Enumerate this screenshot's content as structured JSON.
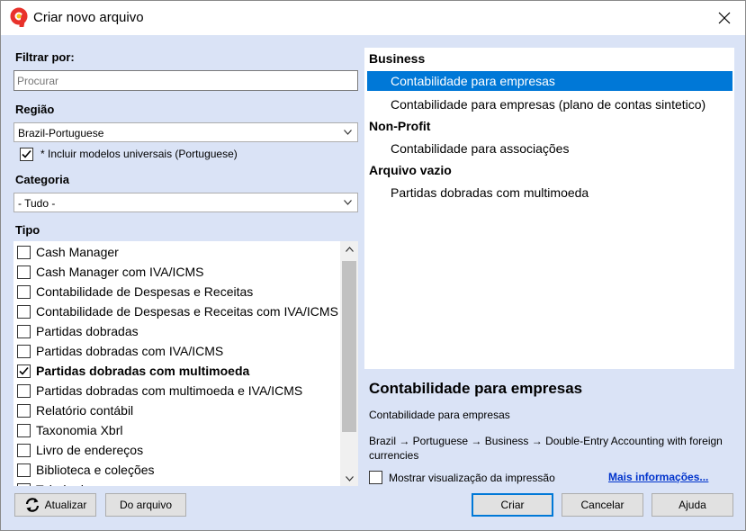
{
  "window": {
    "title": "Criar novo arquivo",
    "app_icon": "banana-9-logo",
    "accent": "#0078d7"
  },
  "filter": {
    "label": "Filtrar por:",
    "search_placeholder": "Procurar"
  },
  "region": {
    "label": "Região",
    "value": "Brazil-Portuguese",
    "include_universal_label": "* Incluir modelos universais (Portuguese)",
    "include_universal_checked": true
  },
  "category": {
    "label": "Categoria",
    "value": "- Tudo -"
  },
  "tipo": {
    "label": "Tipo",
    "items": [
      {
        "label": "Cash Manager",
        "checked": false
      },
      {
        "label": "Cash Manager com IVA/ICMS",
        "checked": false
      },
      {
        "label": "Contabilidade de Despesas e Receitas",
        "checked": false
      },
      {
        "label": "Contabilidade de Despesas e Receitas com IVA/ICMS",
        "checked": false
      },
      {
        "label": "Partidas dobradas",
        "checked": false
      },
      {
        "label": "Partidas dobradas com IVA/ICMS",
        "checked": false
      },
      {
        "label": "Partidas dobradas com multimoeda",
        "checked": true
      },
      {
        "label": "Partidas dobradas com multimoeda e IVA/ICMS",
        "checked": false
      },
      {
        "label": "Relatório contábil",
        "checked": false
      },
      {
        "label": "Taxonomia Xbrl",
        "checked": false
      },
      {
        "label": "Livro de endereços",
        "checked": false
      },
      {
        "label": "Biblioteca e coleções",
        "checked": false
      },
      {
        "label": "Tabela de ...",
        "checked": false
      }
    ]
  },
  "templates": {
    "groups": [
      {
        "name": "Business",
        "items": [
          "Contabilidade para empresas",
          "Contabilidade para empresas (plano de contas sintetico)"
        ]
      },
      {
        "name": "Non-Profit",
        "items": [
          "Contabilidade para associações"
        ]
      },
      {
        "name": "Arquivo vazio",
        "items": [
          "Partidas dobradas com multimoeda"
        ]
      }
    ],
    "selected": "Contabilidade para empresas"
  },
  "detail": {
    "title": "Contabilidade para empresas",
    "description": "Contabilidade para empresas",
    "path": "Brazil → Portuguese → Business → Double-Entry Accounting with foreign currencies",
    "preview_label": "Mostrar visualização da impressão",
    "preview_checked": false,
    "more_info": "Mais informações..."
  },
  "buttons": {
    "refresh": "Atualizar",
    "from_file": "Do arquivo",
    "create": "Criar",
    "cancel": "Cancelar",
    "help": "Ajuda"
  }
}
